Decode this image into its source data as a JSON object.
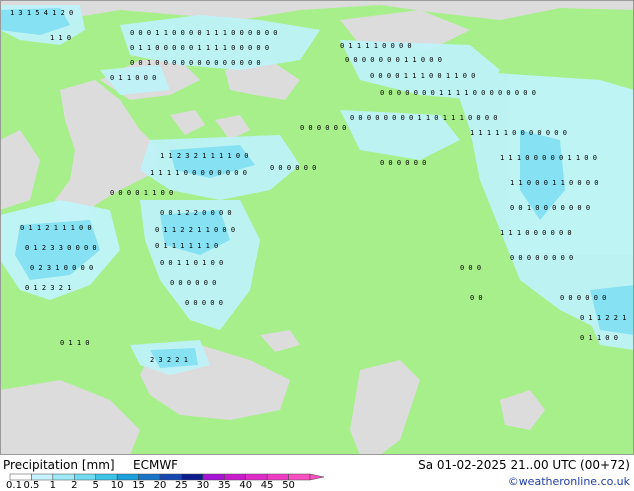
{
  "footer": {
    "title": "Precipitation [mm]",
    "model": "ECMWF",
    "valid_time": "Sa 01-02-2025 21..00 UTC (00+72)",
    "credit": "©weatheronline.co.uk"
  },
  "legend": {
    "ticks": [
      "0.1",
      "0.5",
      "1",
      "2",
      "5",
      "10",
      "15",
      "20",
      "25",
      "30",
      "35",
      "40",
      "45",
      "50"
    ],
    "colors": [
      "#fefefe",
      "#c6f3fb",
      "#9ee9f7",
      "#71dcf1",
      "#3cc4e8",
      "#1aa0dc",
      "#1875c8",
      "#1448b0",
      "#0c1c8c",
      "#a413d6",
      "#c81ccc",
      "#e02cc8",
      "#f03cc4",
      "#f850c0"
    ]
  },
  "map": {
    "colors": {
      "land": "#a7ef8a",
      "sea": "#dcdcdc",
      "precip_light": "#bff3f9",
      "precip_medium": "#86e1f3"
    }
  }
}
